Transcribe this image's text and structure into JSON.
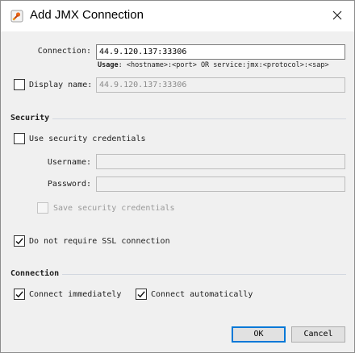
{
  "window": {
    "title": "Add JMX Connection"
  },
  "connection": {
    "label": "Connection:",
    "value": "44.9.120.137:33306",
    "usage_bold": "Usage",
    "usage_text": ": <hostname>:<port> OR service:jmx:<protocol>:<sap>"
  },
  "display_name": {
    "label": "Display name:",
    "value": "44.9.120.137:33306",
    "checked": false
  },
  "security": {
    "title": "Security",
    "use_credentials_label": "Use security credentials",
    "use_credentials_checked": false,
    "username_label": "Username:",
    "username_value": "",
    "password_label": "Password:",
    "password_value": "",
    "save_credentials_label": "Save security credentials",
    "save_credentials_checked": false,
    "no_ssl_label": "Do not require SSL connection",
    "no_ssl_checked": true
  },
  "connection_section": {
    "title": "Connection",
    "connect_immediately_label": "Connect immediately",
    "connect_immediately_checked": true,
    "connect_automatically_label": "Connect automatically",
    "connect_automatically_checked": true
  },
  "buttons": {
    "ok": "OK",
    "cancel": "Cancel"
  },
  "colors": {
    "accent": "#0078d7",
    "background": "#f0f0f0",
    "section_line": "#d2d7e0"
  },
  "icons": {
    "app": "visualvm-app-icon",
    "close": "close-icon",
    "check": "checkmark-icon"
  }
}
